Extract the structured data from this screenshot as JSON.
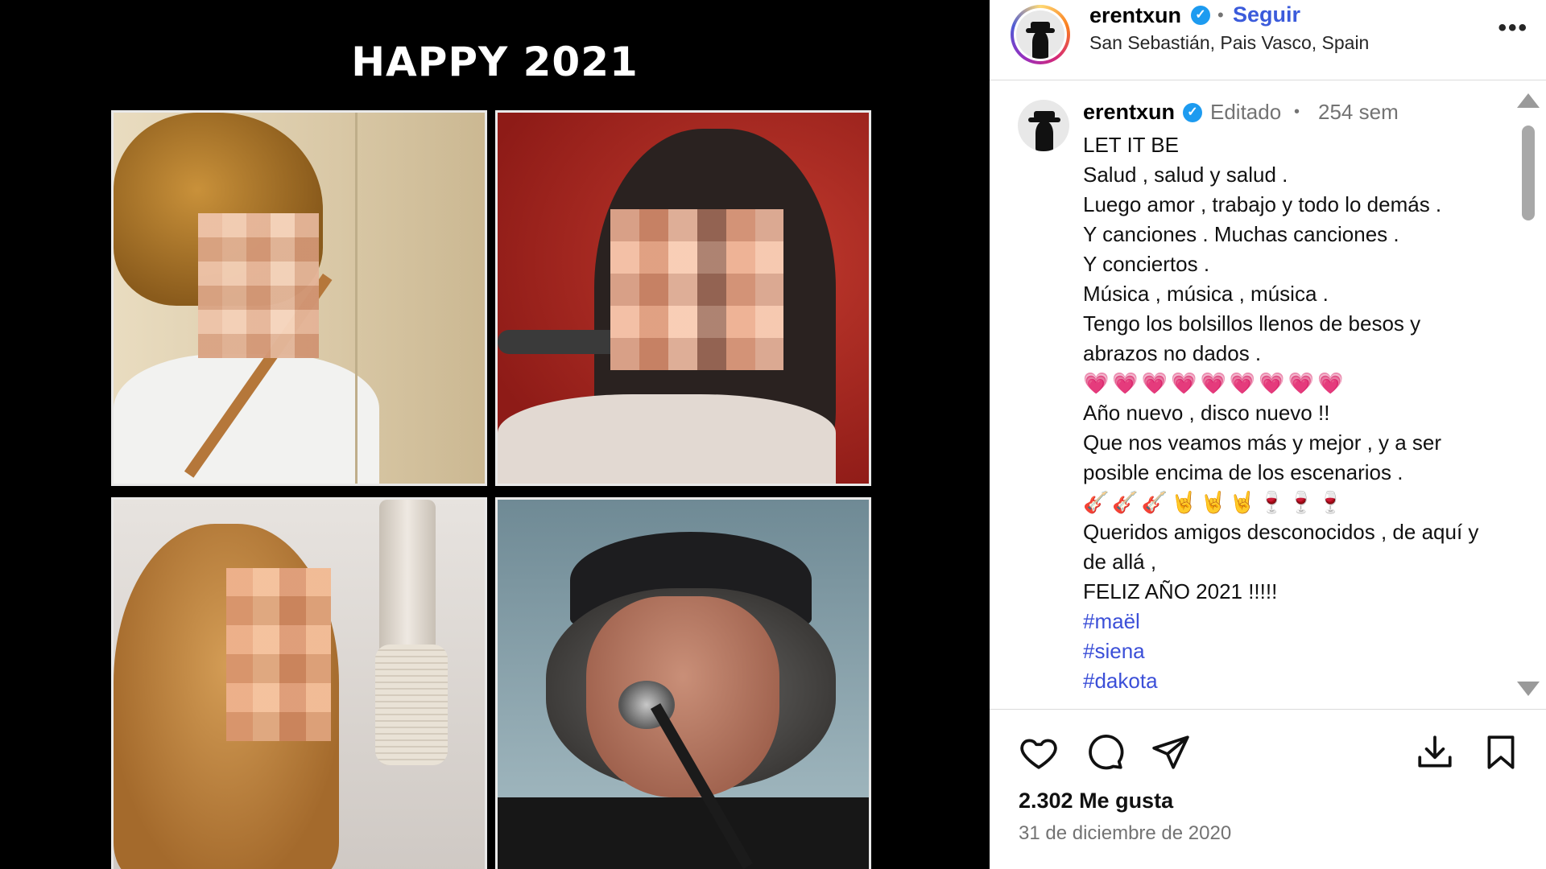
{
  "media": {
    "title": "HAPPY 2021"
  },
  "header": {
    "username": "erentxun",
    "separator": "•",
    "follow_label": "Seguir",
    "location": "San Sebastián, Pais Vasco, Spain",
    "more_icon": "more-options-icon"
  },
  "comment": {
    "username": "erentxun",
    "edited": "Editado",
    "dot": "•",
    "age": "254 sem",
    "caption_lines": [
      "LET IT BE",
      "Salud , salud y salud .",
      "Luego amor , trabajo y todo lo demás .",
      "Y canciones . Muchas canciones .",
      "Y conciertos .",
      "Música , música , música .",
      "Tengo los bolsillos llenos de besos y abrazos no dados .",
      "💗💗💗💗💗💗💗💗💗",
      "Año nuevo , disco nuevo !!",
      "Que nos veamos más y mejor , y a ser posible encima de los escenarios .",
      "🎸🎸🎸🤘🤘🤘🍷🍷🍷",
      "Queridos amigos desconocidos , de aquí y de allá ,",
      "FELIZ AÑO 2021 !!!!!"
    ],
    "hashtags": [
      "#maël",
      "#siena",
      "#dakota"
    ]
  },
  "actions": {
    "like_icon": "heart-icon",
    "comment_icon": "comment-icon",
    "share_icon": "send-icon",
    "download_icon": "download-icon",
    "save_icon": "bookmark-icon"
  },
  "likes_text": "2.302 Me gusta",
  "date_text": "31 de diciembre de 2020",
  "colors": {
    "link": "#3b4fd8",
    "verified": "#1d9bf0"
  }
}
